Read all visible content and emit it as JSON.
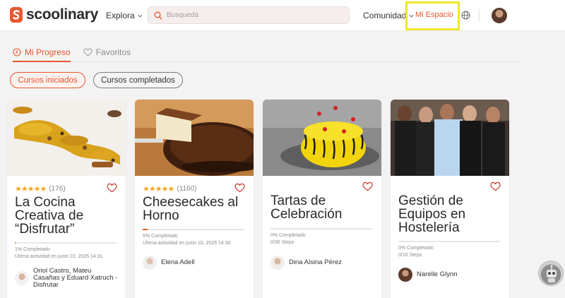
{
  "header": {
    "brand": "scoolinary",
    "explore_label": "Explora",
    "search_placeholder": "Busqueda",
    "community_label": "Comunidad",
    "my_space_label": "Mi Espacio"
  },
  "tabs": [
    {
      "label": "Mi Progreso",
      "active": true
    },
    {
      "label": "Favoritos",
      "active": false
    }
  ],
  "filters": [
    {
      "label": "Cursos iniciados",
      "active": true
    },
    {
      "label": "Cursos completados",
      "active": false
    }
  ],
  "courses": [
    {
      "title": "La Cocina Creativa de “Disfrutar”",
      "stars": "★★★★★",
      "rating_count": "(176)",
      "progress_percent": 1,
      "progress_label": "1% Completado",
      "status_line": "Última actividad en junio 10, 2025 14:31",
      "instructor": "Oriol Castro, Mateu Casañas y Eduard Xatruch - Disfrutar"
    },
    {
      "title": "Cheesecakes al Horno",
      "stars": "★★★★★",
      "rating_count": "(1160)",
      "progress_percent": 5,
      "progress_label": "5% Completado",
      "status_line": "Última actividad en junio 10, 2025 14:30",
      "instructor": "Elena Adell"
    },
    {
      "title": "Tartas de Celebración",
      "progress_percent": 0,
      "progress_label": "0% Completado",
      "status_line": "0/36 Steps",
      "instructor": "Dina Alsina Pérez"
    },
    {
      "title": "Gestión de Equipos en Hostelería",
      "progress_percent": 0,
      "progress_label": "0% Completado",
      "status_line": "0/16 Steps",
      "instructor": "Narelle Glynn"
    }
  ],
  "colors": {
    "accent": "#e8562f",
    "highlight_box": "#f2e531",
    "star": "#f5a623"
  }
}
